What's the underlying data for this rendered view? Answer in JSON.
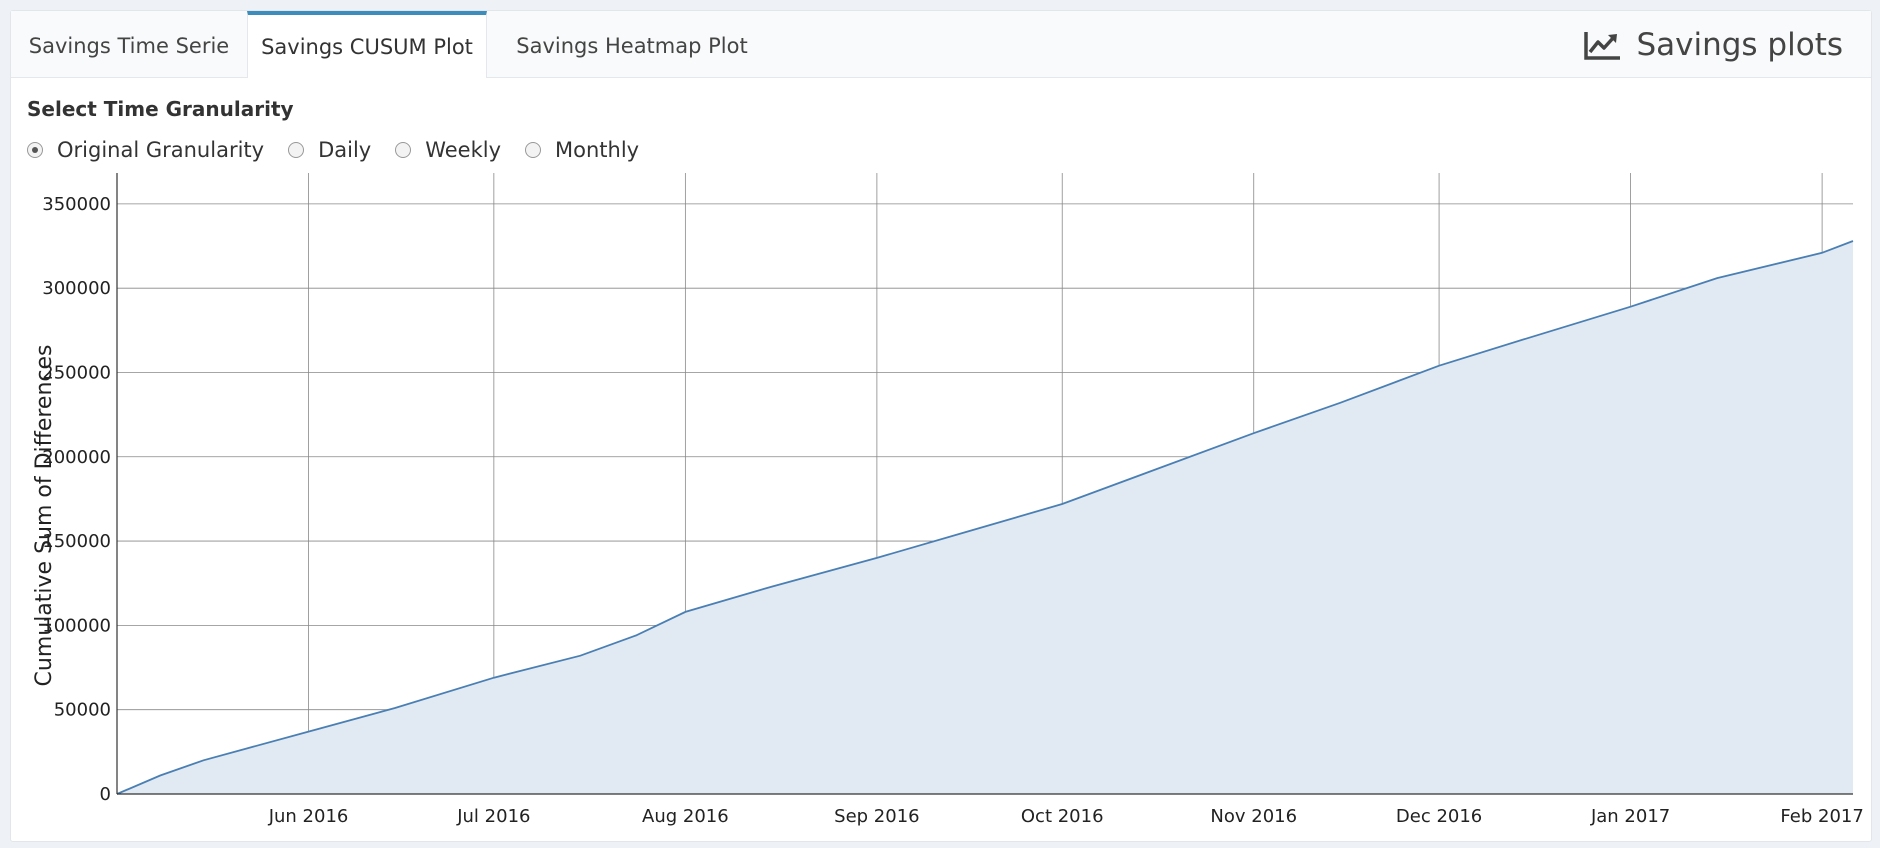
{
  "tabs": [
    {
      "label": "Savings Time Serie",
      "active": false
    },
    {
      "label": "Savings CUSUM Plot",
      "active": true
    },
    {
      "label": "Savings Heatmap Plot",
      "active": false
    }
  ],
  "box_title": {
    "text": "Savings plots",
    "icon": "line-chart-icon"
  },
  "granularity": {
    "label": "Select Time Granularity",
    "options": [
      {
        "label": "Original Granularity",
        "checked": true
      },
      {
        "label": "Daily",
        "checked": false
      },
      {
        "label": "Weekly",
        "checked": false
      },
      {
        "label": "Monthly",
        "checked": false
      }
    ]
  },
  "colors": {
    "accent": "#3c8dbc",
    "line": "#4a7fb4",
    "fill": "#e1eaf2",
    "grid": "#888888"
  },
  "chart_data": {
    "type": "area",
    "title": "",
    "xlabel": "",
    "ylabel": "Cumulative Sum of Differences",
    "ylim": [
      0,
      360000
    ],
    "xlim": [
      "2016-05-01",
      "2017-02-06"
    ],
    "y_ticks": [
      0,
      50000,
      100000,
      150000,
      200000,
      250000,
      300000,
      350000
    ],
    "y_tick_labels": [
      "0",
      "50000",
      "100000",
      "150000",
      "200000",
      "250000",
      "300000",
      "350000"
    ],
    "x_ticks": [
      "2016-06-01",
      "2016-07-01",
      "2016-08-01",
      "2016-09-01",
      "2016-10-01",
      "2016-11-01",
      "2016-12-01",
      "2017-01-01",
      "2017-02-01"
    ],
    "x_tick_labels": [
      "Jun 2016",
      "Jul 2016",
      "Aug 2016",
      "Sep 2016",
      "Oct 2016",
      "Nov 2016",
      "Dec 2016",
      "Jan 2017",
      "Feb 2017"
    ],
    "grid": true,
    "series": [
      {
        "x": [
          "2016-05-01",
          "2016-05-08",
          "2016-05-15",
          "2016-05-22",
          "2016-06-01",
          "2016-06-15",
          "2016-07-01",
          "2016-07-15",
          "2016-07-24",
          "2016-08-01",
          "2016-08-15",
          "2016-09-01",
          "2016-09-15",
          "2016-10-01",
          "2016-10-15",
          "2016-11-01",
          "2016-11-15",
          "2016-12-01",
          "2016-12-15",
          "2017-01-01",
          "2017-01-15",
          "2017-02-01",
          "2017-02-06"
        ],
        "y": [
          0,
          11000,
          20000,
          27000,
          37000,
          51000,
          69000,
          82000,
          94000,
          108000,
          123000,
          140000,
          155000,
          172000,
          191000,
          214000,
          232000,
          254000,
          270000,
          289000,
          306000,
          321000,
          328000
        ]
      }
    ]
  }
}
